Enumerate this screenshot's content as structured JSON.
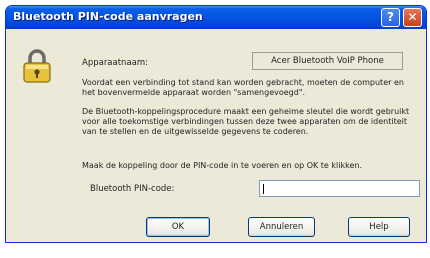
{
  "window": {
    "title": "Bluetooth PIN-code aanvragen",
    "help_glyph": "?",
    "close_glyph": "✕"
  },
  "device": {
    "label": "Apparaatnaam:",
    "value": "Acer Bluetooth VoIP Phone"
  },
  "paragraphs": [
    "Voordat een verbinding tot stand kan worden gebracht, moeten de computer en het bovenvermelde apparaat worden \"samengevoegd\".",
    "De Bluetooth-koppelingsprocedure maakt een geheime sleutel die wordt gebruikt voor alle toekomstige verbindingen tussen deze twee apparaten om de identiteit van te stellen en de uitgewisselde gegevens te coderen.",
    "Maak de koppeling door de PIN-code in te voeren en op OK te klikken."
  ],
  "pin": {
    "label": "Bluetooth PIN-code:",
    "value": "",
    "placeholder": ""
  },
  "buttons": {
    "ok": "OK",
    "cancel": "Annuleren",
    "help": "Help"
  },
  "icons": {
    "window_icon": "lock-icon"
  },
  "colors": {
    "titlebar": "#0554e3",
    "dialog_bg": "#ece9d8",
    "close_button": "#c8411c"
  }
}
